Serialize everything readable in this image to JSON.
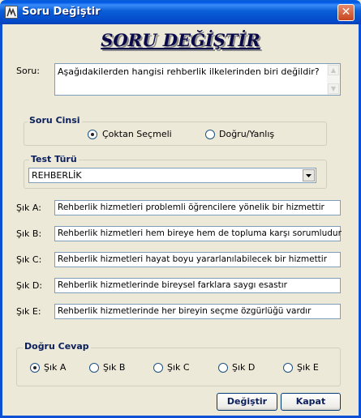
{
  "window": {
    "title": "Soru Değiştir",
    "close_glyph": "✕"
  },
  "heading": "SORU DEĞİŞTİR",
  "question": {
    "label": "Soru:",
    "value": "Aşağıdakilerden hangisi rehberlik ilkelerinden biri değildir?"
  },
  "question_type": {
    "title": "Soru Cinsi",
    "options": [
      {
        "label": "Çoktan Seçmeli",
        "selected": true
      },
      {
        "label": "Doğru/Yanlış",
        "selected": false
      }
    ]
  },
  "test_type": {
    "title": "Test Türü",
    "selected": "REHBERLİK"
  },
  "choices": [
    {
      "label": "Şık A:",
      "value": "Rehberlik hizmetleri problemli öğrencilere yönelik bir hizmettir"
    },
    {
      "label": "Şık B:",
      "value": "Rehberlik hizmetleri hem bireye hem de topluma karşı sorumludur"
    },
    {
      "label": "Şık C:",
      "value": "Rehberlik hizmetleri hayat boyu yararlanılabilecek bir hizmettir"
    },
    {
      "label": "Şık D:",
      "value": "Rehberlik hizmetlerinde bireysel farklara saygı esastır"
    },
    {
      "label": "Şık E:",
      "value": "Rehberlik hizmetlerinde her bireyin seçme özgürlüğü vardır"
    }
  ],
  "correct_answer": {
    "title": "Doğru Cevap",
    "options": [
      {
        "label": "Şık A",
        "selected": true
      },
      {
        "label": "Şık B",
        "selected": false
      },
      {
        "label": "Şık C",
        "selected": false
      },
      {
        "label": "Şık D",
        "selected": false
      },
      {
        "label": "Şık E",
        "selected": false
      }
    ]
  },
  "buttons": {
    "change": "Değiştir",
    "close": "Kapat"
  }
}
